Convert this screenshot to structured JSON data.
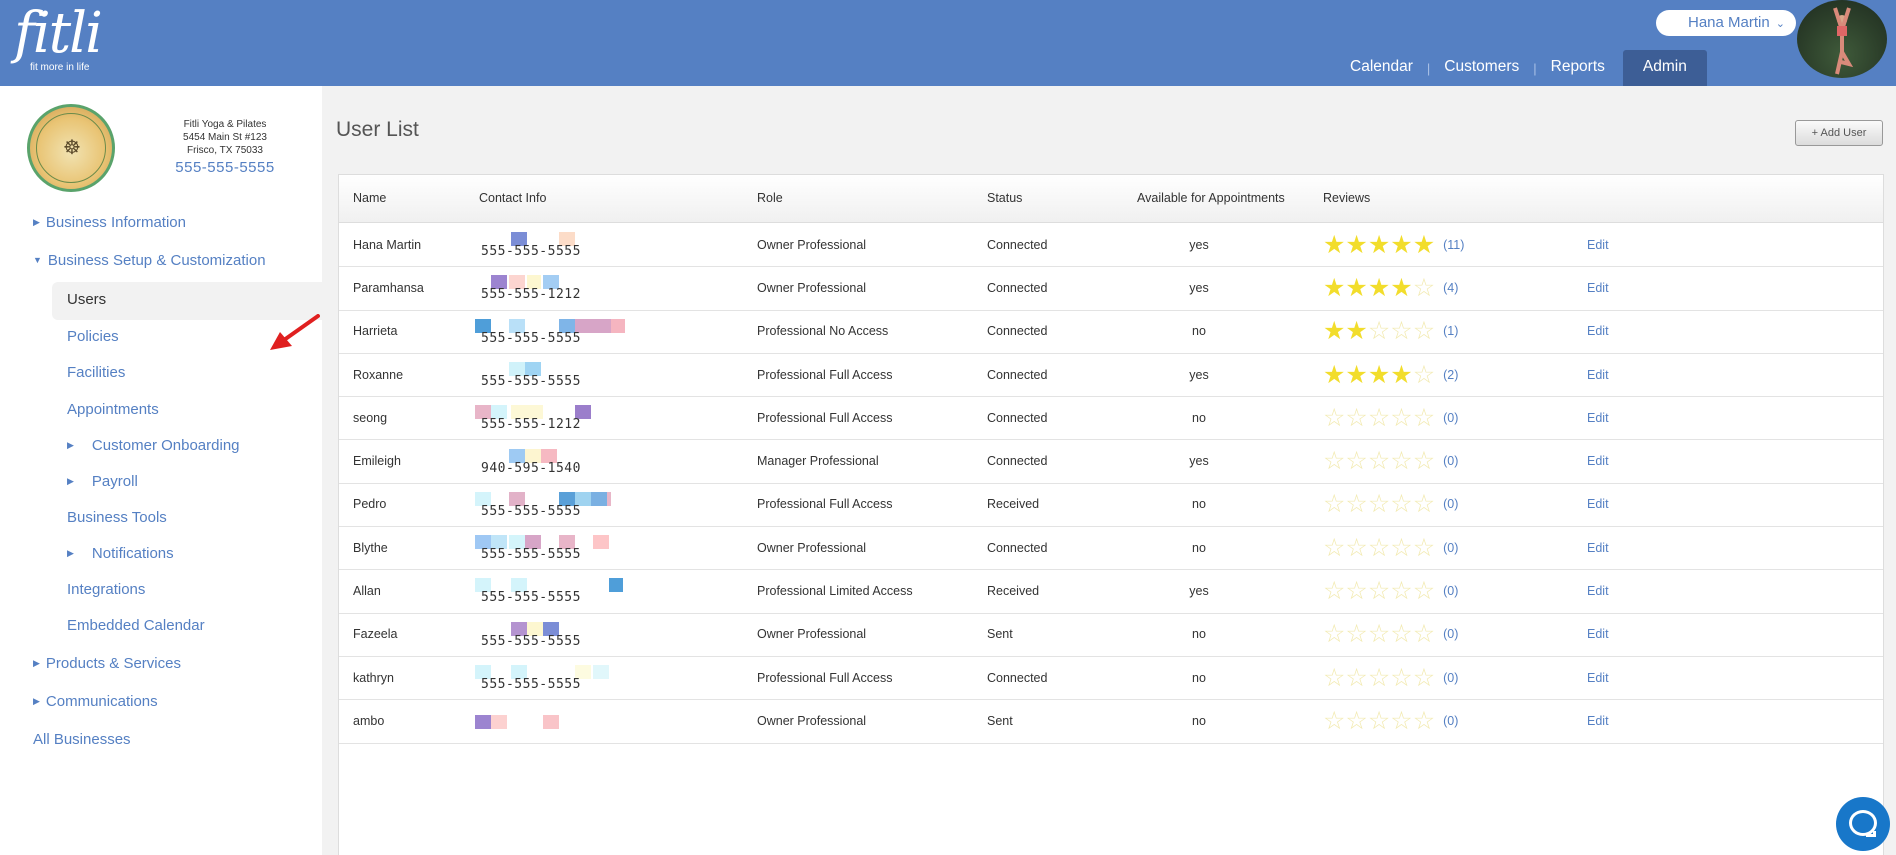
{
  "brand": {
    "logo_text": "fitli",
    "tagline": "fit more in life"
  },
  "header": {
    "user_name": "Hana Martin",
    "nav": [
      {
        "label": "Calendar"
      },
      {
        "label": "Customers"
      },
      {
        "label": "Reports"
      },
      {
        "label": "Admin",
        "active": true
      }
    ]
  },
  "business": {
    "name": "Fitli Yoga & Pilates",
    "address1": "5454 Main St #123",
    "address2": "Frisco, TX 75033",
    "phone": "555-555-5555"
  },
  "sidebar": {
    "items": [
      {
        "label": "Business Information"
      },
      {
        "label": "Business Setup & Customization"
      },
      {
        "label": "Users"
      },
      {
        "label": "Policies"
      },
      {
        "label": "Facilities"
      },
      {
        "label": "Appointments"
      },
      {
        "label": "Customer Onboarding"
      },
      {
        "label": "Payroll"
      },
      {
        "label": "Business Tools"
      },
      {
        "label": "Notifications"
      },
      {
        "label": "Integrations"
      },
      {
        "label": "Embedded Calendar"
      },
      {
        "label": "Products & Services"
      },
      {
        "label": "Communications"
      },
      {
        "label": "All Businesses"
      }
    ]
  },
  "main": {
    "title": "User List",
    "add_button": "+ Add User",
    "columns": [
      "Name",
      "Contact Info",
      "Role",
      "Status",
      "Available for Appointments",
      "Reviews"
    ],
    "edit_label": "Edit",
    "rows": [
      {
        "name": "Hana Martin",
        "phone": "555-555-5555",
        "role": "Owner Professional",
        "status": "Connected",
        "available": "yes",
        "stars": 5,
        "count": "(11)"
      },
      {
        "name": "Paramhansa",
        "phone": "555-555-1212",
        "role": "Owner Professional",
        "status": "Connected",
        "available": "yes",
        "stars": 4,
        "count": "(4)"
      },
      {
        "name": "Harrieta",
        "phone": "555-555-5555",
        "role": "Professional No Access",
        "status": "Connected",
        "available": "no",
        "stars": 2,
        "count": "(1)"
      },
      {
        "name": "Roxanne",
        "phone": "555-555-5555",
        "role": "Professional Full Access",
        "status": "Connected",
        "available": "yes",
        "stars": 4,
        "count": "(2)"
      },
      {
        "name": "seong",
        "phone": "555-555-1212",
        "role": "Professional Full Access",
        "status": "Connected",
        "available": "no",
        "stars": 0,
        "count": "(0)"
      },
      {
        "name": "Emileigh",
        "phone": "940-595-1540",
        "role": "Manager Professional",
        "status": "Connected",
        "available": "yes",
        "stars": 0,
        "count": "(0)"
      },
      {
        "name": "Pedro",
        "phone": "555-555-5555",
        "role": "Professional Full Access",
        "status": "Received",
        "available": "no",
        "stars": 0,
        "count": "(0)"
      },
      {
        "name": "Blythe",
        "phone": "555-555-5555",
        "role": "Owner Professional",
        "status": "Connected",
        "available": "no",
        "stars": 0,
        "count": "(0)"
      },
      {
        "name": "Allan",
        "phone": "555-555-5555",
        "role": "Professional Limited Access",
        "status": "Received",
        "available": "yes",
        "stars": 0,
        "count": "(0)"
      },
      {
        "name": "Fazeela",
        "phone": "555-555-5555",
        "role": "Owner Professional",
        "status": "Sent",
        "available": "no",
        "stars": 0,
        "count": "(0)"
      },
      {
        "name": "kathryn",
        "phone": "555-555-5555",
        "role": "Professional Full Access",
        "status": "Connected",
        "available": "no",
        "stars": 0,
        "count": "(0)"
      },
      {
        "name": "ambo",
        "phone": "",
        "role": "Owner Professional",
        "status": "Sent",
        "available": "no",
        "stars": 0,
        "count": "(0)"
      }
    ]
  },
  "colors": {
    "header": "#5580c3",
    "link": "#5580c3",
    "star": "#f2dd2c",
    "arrow": "#e02020"
  },
  "icons": [
    "chevron-down-icon",
    "star-icon",
    "caret-right-icon",
    "caret-down-icon",
    "arrow-icon",
    "chat-icon"
  ]
}
